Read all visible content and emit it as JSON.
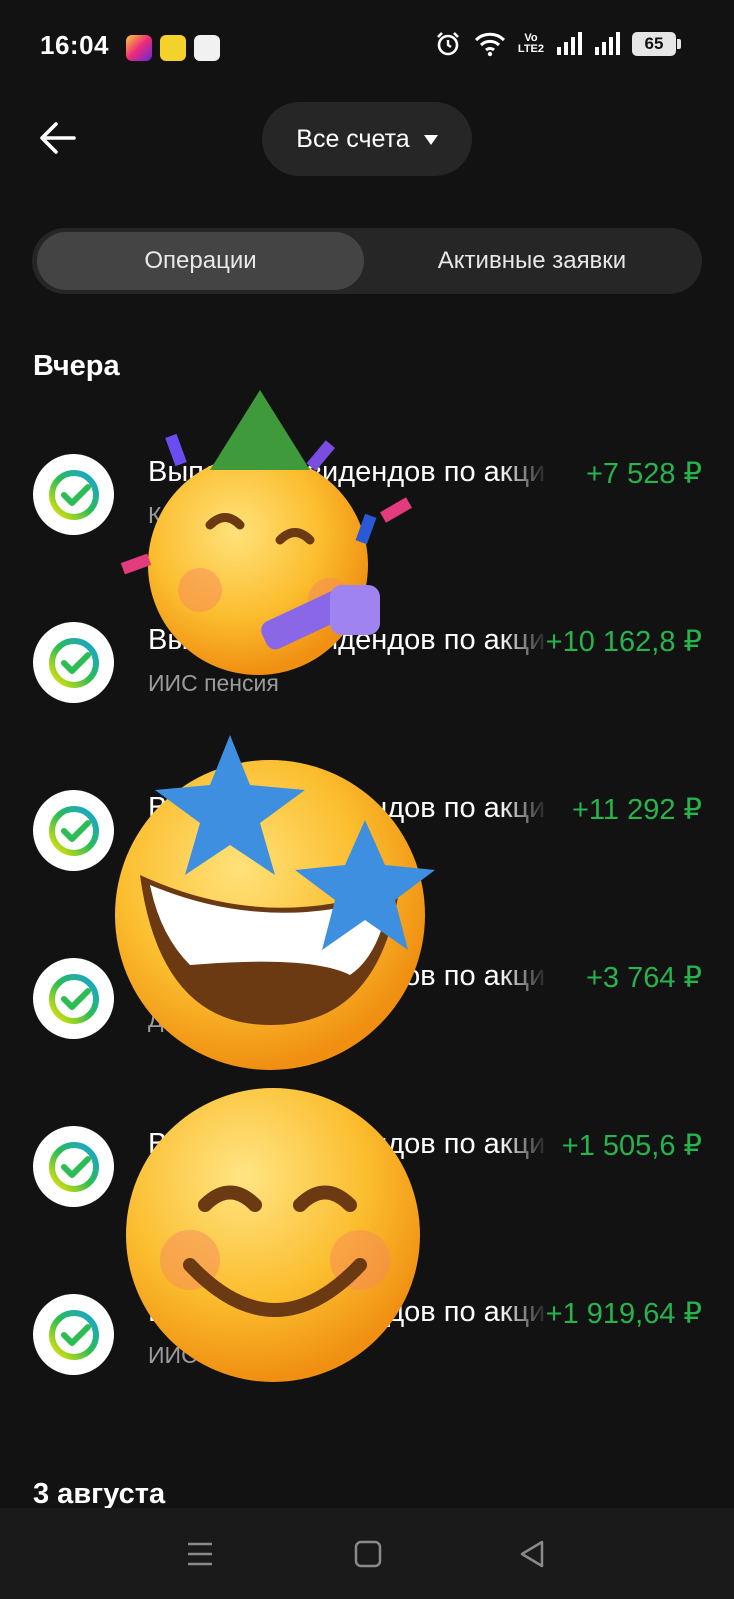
{
  "status_bar": {
    "time": "16:04",
    "volte_top": "Vo",
    "volte_bottom": "LTE2",
    "battery": "65",
    "icons": [
      "instagram-icon",
      "app-icon",
      "app-icon",
      "alarm-icon",
      "wifi-icon",
      "volte-icon",
      "signal-icon",
      "signal-icon",
      "battery-icon"
    ]
  },
  "header": {
    "back_icon": "arrow-left-icon",
    "account_selector": "Все счета"
  },
  "tabs": {
    "operations": "Операции",
    "active_requests": "Активные заявки"
  },
  "sections": [
    {
      "title": "Вчера",
      "items": [
        {
          "title": "Выплата дивидендов по акциям",
          "subtitle": "К",
          "amount": "+7 528 ₽"
        },
        {
          "title": "Выплата дивидендов по акциям",
          "subtitle": "ИИС пенсия",
          "amount": "+10 162,8 ₽"
        },
        {
          "title": "Выплата дивидендов по акциям",
          "subtitle": "",
          "amount": "+11 292 ₽"
        },
        {
          "title": "Выплата дивидендов по акциям",
          "subtitle": "Д",
          "amount": "+3 764 ₽"
        },
        {
          "title": "Выплата дивидендов по акциям",
          "subtitle": "",
          "amount": "+1 505,6 ₽"
        },
        {
          "title": "Выплата дивидендов по акциям",
          "subtitle": "ИИС п",
          "amount": "+1 919,64 ₽"
        }
      ]
    },
    {
      "title": "3 августа",
      "items": []
    }
  ],
  "nav": {
    "menu_icon": "menu-icon",
    "home_icon": "home-square-icon",
    "back_icon": "back-triangle-icon"
  },
  "colors": {
    "background": "#121212",
    "amount_positive": "#27b34e",
    "pill": "#262626"
  }
}
